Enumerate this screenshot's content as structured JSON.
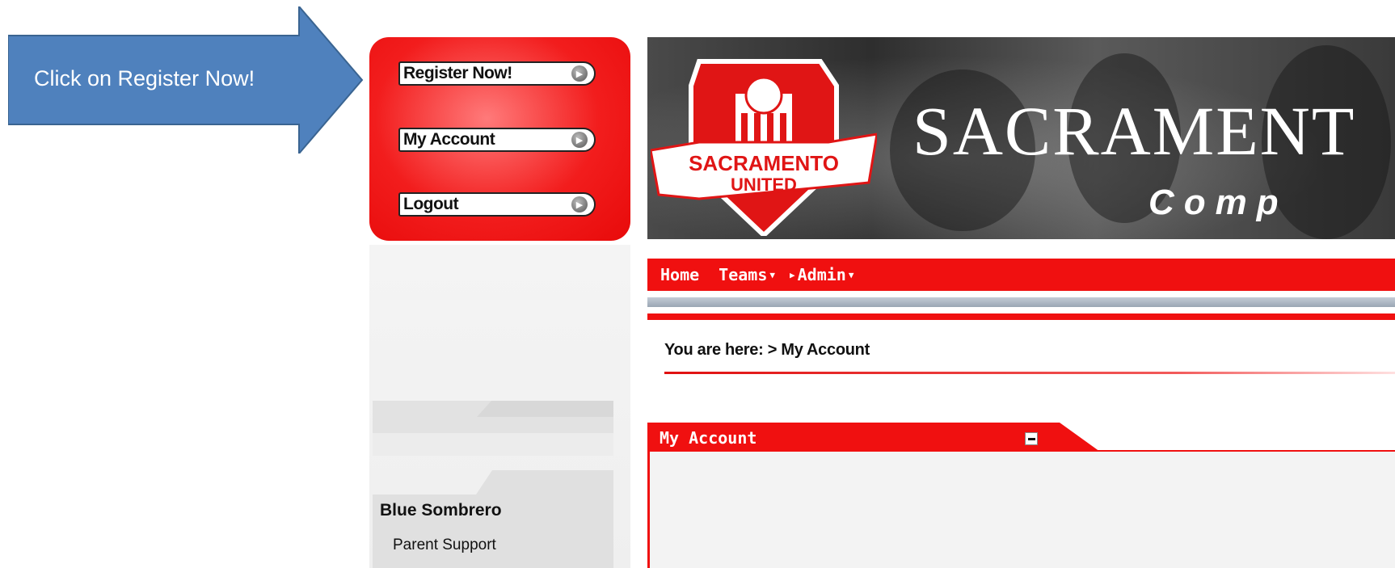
{
  "callout": {
    "text": "Click on Register Now!"
  },
  "login_box": {
    "buttons": [
      {
        "label": "Register Now!"
      },
      {
        "label": "My Account"
      },
      {
        "label": "Logout"
      }
    ]
  },
  "banner": {
    "crest_top": "SACRAMENTO",
    "crest_bottom": "UNITED",
    "title": "SACRAMENT",
    "subtitle": "Comp"
  },
  "nav": {
    "items": [
      {
        "label": "Home"
      },
      {
        "label": "Teams"
      },
      {
        "label": "Admin"
      }
    ]
  },
  "breadcrumb": {
    "prefix": "You are here: > ",
    "current": "My Account"
  },
  "panel": {
    "title": "My Account"
  },
  "sidebar": {
    "heading": "Blue Sombrero",
    "link": "Parent Support"
  },
  "colors": {
    "brand_red": "#f01010",
    "callout_blue": "#4f81bd"
  }
}
